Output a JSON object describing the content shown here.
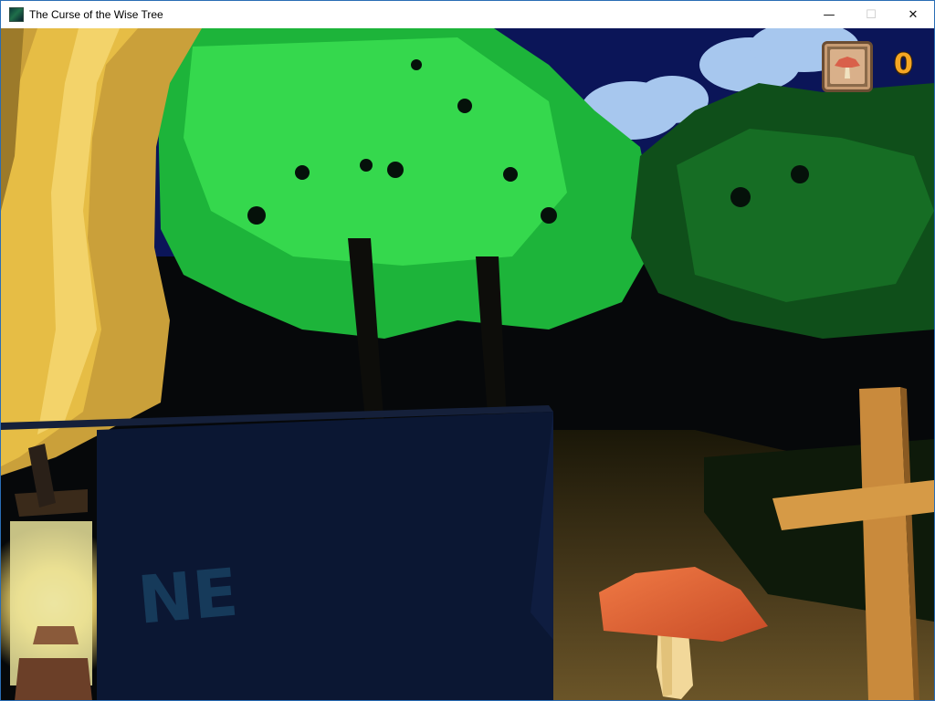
{
  "window": {
    "title": "The Curse of the Wise Tree",
    "controls": {
      "minimize": "—",
      "maximize": "☐",
      "close": "✕"
    }
  },
  "hud": {
    "collected_item": "mushroom",
    "mushroom_count": "0",
    "counter_color": "#f5a623"
  },
  "scene": {
    "sign_text": "NE",
    "objects": [
      "tree-trunk",
      "lantern",
      "signboard",
      "mushroom",
      "wooden-cross",
      "forest-canopy",
      "night-sky",
      "clouds"
    ]
  },
  "colors": {
    "sky": "#0a1560",
    "foliage": "#1fc43a",
    "trunk": "#e0b543",
    "mushroom_cap": "#e86a3a",
    "cross": "#c98a3c"
  }
}
